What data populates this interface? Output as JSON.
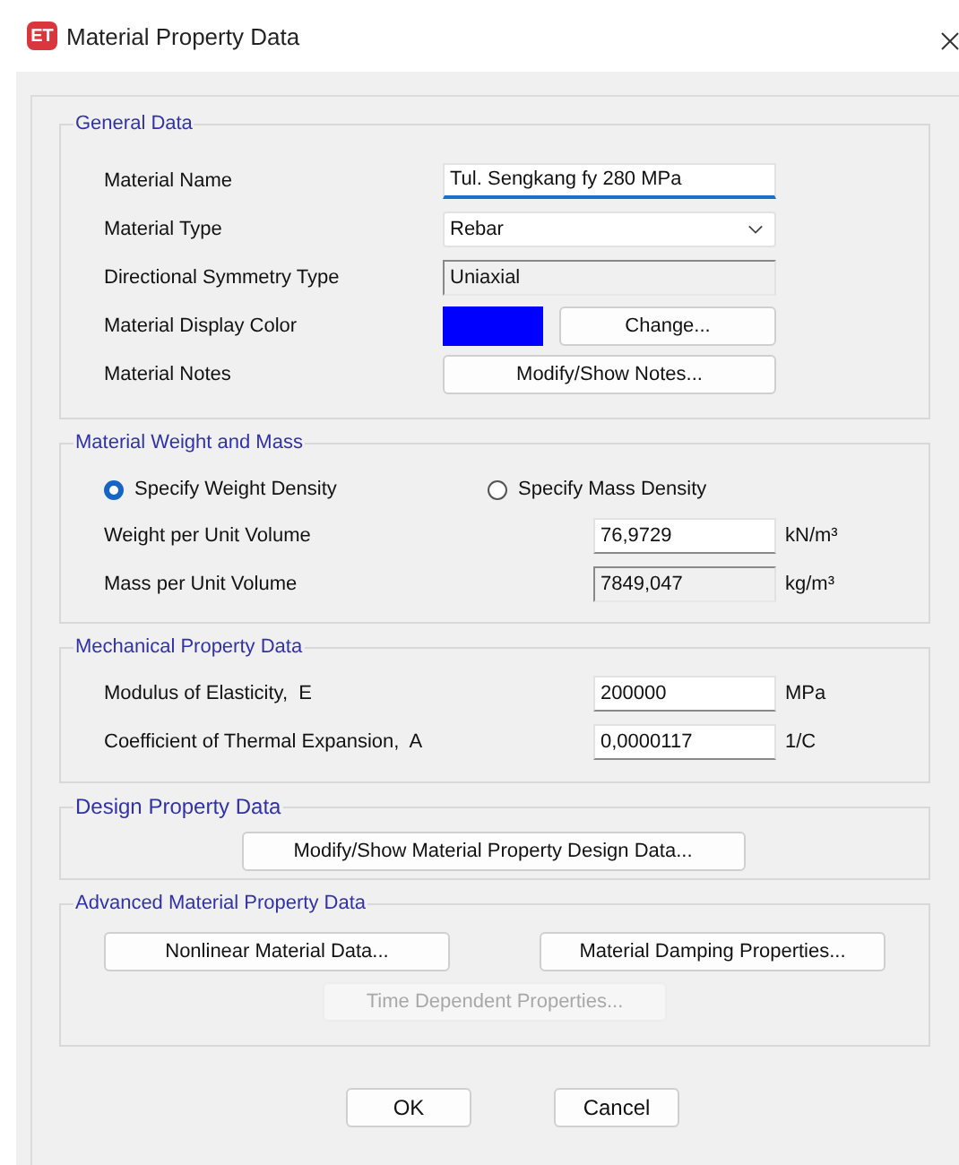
{
  "window": {
    "app_badge": "ET",
    "title": "Material Property Data"
  },
  "general": {
    "legend": "General Data",
    "rows": [
      {
        "label": "Material Name",
        "kind": "input",
        "value": "Tul. Sengkang fy 280 MPa",
        "focused": true
      },
      {
        "label": "Material Type",
        "kind": "dropdown",
        "value": "Rebar"
      },
      {
        "label": "Directional Symmetry Type",
        "kind": "readonly",
        "value": "Uniaxial"
      },
      {
        "label": "Material Display Color",
        "kind": "color",
        "color": "#0000ff",
        "button": "Change..."
      },
      {
        "label": "Material Notes",
        "kind": "button",
        "button": "Modify/Show Notes..."
      }
    ]
  },
  "weight": {
    "legend": "Material Weight and Mass",
    "options": [
      {
        "label": "Specify Weight Density",
        "selected": true
      },
      {
        "label": "Specify Mass Density",
        "selected": false
      }
    ],
    "rows": [
      {
        "label": "Weight per Unit Volume",
        "value": "76,9729",
        "unit": "kN/m³",
        "readonly": false
      },
      {
        "label": "Mass per Unit Volume",
        "value": "7849,047",
        "unit": "kg/m³",
        "readonly": true
      }
    ]
  },
  "mechanical": {
    "legend": "Mechanical Property Data",
    "rows": [
      {
        "label": "Modulus of Elasticity,  E",
        "value": "200000",
        "unit": "MPa",
        "readonly": false
      },
      {
        "label": "Coefficient of Thermal Expansion,  A",
        "value": "0,0000117",
        "unit": "1/C",
        "readonly": false
      }
    ]
  },
  "design": {
    "legend": "Design Property Data",
    "button": "Modify/Show Material Property Design Data..."
  },
  "advanced": {
    "legend": "Advanced Material Property Data",
    "buttons": [
      {
        "label": "Nonlinear Material Data...",
        "disabled": false
      },
      {
        "label": "Material Damping Properties...",
        "disabled": false
      },
      {
        "label": "Time Dependent Properties...",
        "disabled": true
      }
    ]
  },
  "footer": {
    "buttons": [
      "OK",
      "Cancel"
    ]
  }
}
